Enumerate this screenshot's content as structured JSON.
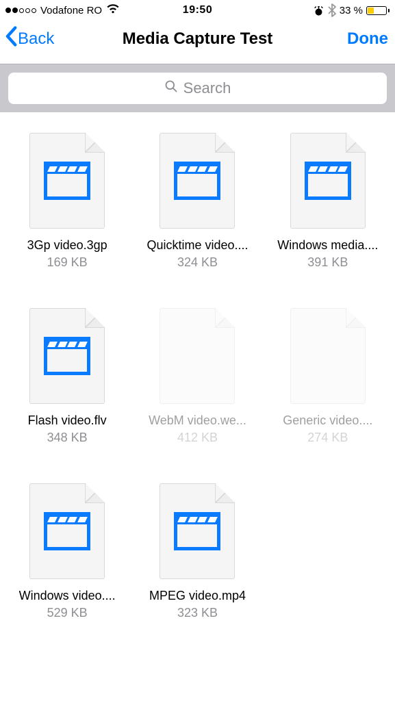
{
  "status_bar": {
    "signal_dots_filled": 2,
    "signal_dots_total": 5,
    "carrier": "Vodafone RO",
    "time": "19:50",
    "battery_percent": "33 %",
    "battery_fill_pct": 33,
    "battery_color": "#ffcc00",
    "alarm_icon": "alarm-icon",
    "bluetooth_icon": "bluetooth-icon",
    "wifi_icon": "wifi-icon"
  },
  "nav": {
    "back_label": "Back",
    "title": "Media Capture Test",
    "done_label": "Done"
  },
  "search": {
    "placeholder": "Search"
  },
  "files": [
    {
      "name": "3Gp video.3gp",
      "size": "169 KB",
      "supported": true
    },
    {
      "name": "Quicktime video....",
      "size": "324 KB",
      "supported": true
    },
    {
      "name": "Windows media....",
      "size": "391 KB",
      "supported": true
    },
    {
      "name": "Flash video.flv",
      "size": "348 KB",
      "supported": true
    },
    {
      "name": "WebM video.we...",
      "size": "412 KB",
      "supported": false
    },
    {
      "name": "Generic video....",
      "size": "274 KB",
      "supported": false
    },
    {
      "name": "Windows video....",
      "size": "529 KB",
      "supported": true
    },
    {
      "name": "MPEG video.mp4",
      "size": "323 KB",
      "supported": true
    }
  ],
  "colors": {
    "accent": "#007aff",
    "icon_blue": "#0a7aff",
    "gray_text": "#8e8e93",
    "search_bg": "#c8c8cd"
  }
}
